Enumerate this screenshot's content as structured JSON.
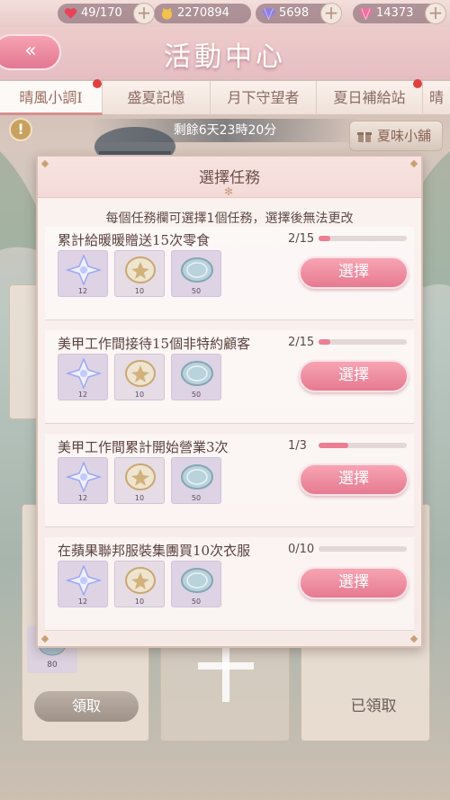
{
  "resources": [
    {
      "name": "stamina",
      "value": "49/170",
      "icon": "heart-icon",
      "color": "#e8415a"
    },
    {
      "name": "gold",
      "value": "2270894",
      "icon": "cat-coin-icon",
      "color": "#f2c14e"
    },
    {
      "name": "diamond",
      "value": "5698",
      "icon": "diamond-icon",
      "color": "#8f7ee8"
    },
    {
      "name": "pink-diamond",
      "value": "14373",
      "icon": "pink-diamond-icon",
      "color": "#f06fa0"
    }
  ],
  "header": {
    "title": "活動中心",
    "back_icon": "double-chevron-left-icon"
  },
  "tabs": [
    {
      "label": "晴風小調I",
      "active": true,
      "has_dot": true
    },
    {
      "label": "盛夏記憶",
      "active": false,
      "has_dot": false
    },
    {
      "label": "月下守望者",
      "active": false,
      "has_dot": false
    },
    {
      "label": "夏日補給站",
      "active": false,
      "has_dot": true
    },
    {
      "label": "晴",
      "active": false,
      "has_dot": false
    }
  ],
  "timer": "剩餘6天23時20分",
  "shop_label": "夏味小舖",
  "background": {
    "claim_label": "領取",
    "claimed_label": "已領取",
    "coin_qty": "80"
  },
  "modal": {
    "title": "選擇任務",
    "note": "每個任務欄可選擇1個任務，選擇後無法更改",
    "tasks": [
      {
        "title": "累計給暖暖贈送15次零食",
        "progress_text": "2/15",
        "progress": 0.133,
        "button": "選擇",
        "rewards": [
          "12",
          "10",
          "50"
        ]
      },
      {
        "title": "美甲工作間接待15個非特約顧客",
        "progress_text": "2/15",
        "progress": 0.133,
        "button": "選擇",
        "rewards": [
          "12",
          "10",
          "50"
        ]
      },
      {
        "title": "美甲工作間累計開始營業3次",
        "progress_text": "1/3",
        "progress": 0.333,
        "button": "選擇",
        "rewards": [
          "12",
          "10",
          "50"
        ]
      },
      {
        "title": "在蘋果聯邦服裝集團買10次衣服",
        "progress_text": "0/10",
        "progress": 0,
        "button": "選擇",
        "rewards": [
          "12",
          "10",
          "50"
        ]
      }
    ]
  },
  "reward_icons": [
    "crystal-star-icon",
    "gold-medal-coin-icon",
    "silver-coin-icon"
  ]
}
